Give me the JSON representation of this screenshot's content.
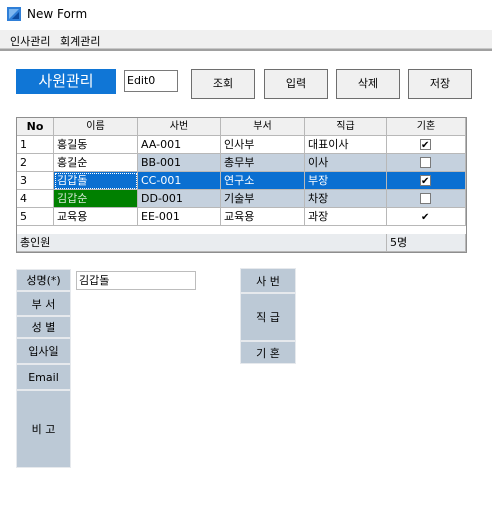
{
  "window": {
    "title": "New Form",
    "icon": "app-form-icon"
  },
  "menu": {
    "items": [
      "인사관리",
      "회계관리"
    ]
  },
  "header": {
    "title": "사원관리",
    "edit_value": "Edit0"
  },
  "buttons": {
    "search": "조회",
    "input": "입력",
    "delete": "삭제",
    "save": "저장"
  },
  "grid": {
    "columns": [
      "No",
      "이름",
      "사번",
      "부서",
      "직급",
      "기혼"
    ],
    "rows": [
      {
        "no": "1",
        "name": "홍길동",
        "id": "AA-001",
        "dept": "인사부",
        "rank": "대표이사",
        "married": true
      },
      {
        "no": "2",
        "name": "홍길순",
        "id": "BB-001",
        "dept": "총무부",
        "rank": "이사",
        "married": false
      },
      {
        "no": "3",
        "name": "김갑돌",
        "id": "CC-001",
        "dept": "연구소",
        "rank": "부장",
        "married": true
      },
      {
        "no": "4",
        "name": "김갑순",
        "id": "DD-001",
        "dept": "기술부",
        "rank": "차장",
        "married": false
      },
      {
        "no": "5",
        "name": "교육용",
        "id": "EE-001",
        "dept": "교육용",
        "rank": "과장",
        "married": true
      }
    ],
    "footer_label": "총인원",
    "footer_count": "5명",
    "selected_row": 3
  },
  "form": {
    "name_label": "성명(*)",
    "name_value": "김갑돌",
    "dept_label": "부 서",
    "gender_label": "성 별",
    "join_label": "입사일",
    "email_label": "Email",
    "note_label": "비 고",
    "emp_no_label": "사 번",
    "rank_label": "직 급",
    "married_label": "기 혼"
  },
  "colors": {
    "accent": "#1076d6",
    "selected_row": "#0a6fd1",
    "green_cell": "#008000",
    "label_bg": "#bcc9d6",
    "alt_row": "#c5d1de"
  }
}
